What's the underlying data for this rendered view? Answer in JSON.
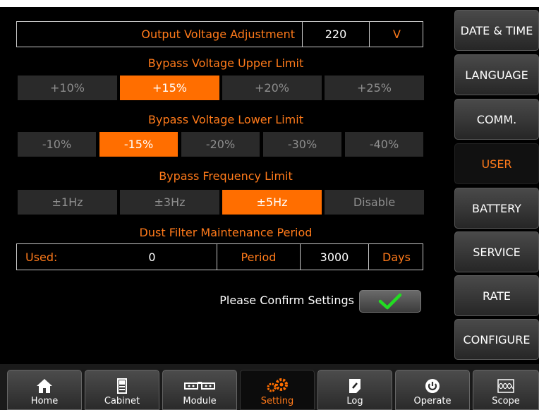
{
  "output_voltage": {
    "label": "Output Voltage Adjustment",
    "value": "220",
    "unit": "V"
  },
  "bypass_upper": {
    "title": "Bypass Voltage Upper Limit",
    "options": [
      "+10%",
      "+15%",
      "+20%",
      "+25%"
    ],
    "selected": "+15%"
  },
  "bypass_lower": {
    "title": "Bypass Voltage Lower Limit",
    "options": [
      "-10%",
      "-15%",
      "-20%",
      "-30%",
      "-40%"
    ],
    "selected": "-15%"
  },
  "bypass_freq": {
    "title": "Bypass Frequency Limit",
    "options": [
      "±1Hz",
      "±3Hz",
      "±5Hz",
      "Disable"
    ],
    "selected": "±5Hz"
  },
  "dust_filter": {
    "title": "Dust Filter Maintenance Period",
    "used_label": "Used:",
    "used_value": "0",
    "period_label": "Period",
    "period_value": "3000",
    "unit": "Days"
  },
  "confirm": {
    "label": "Please Confirm Settings",
    "icon": "check-icon"
  },
  "right_menu": {
    "items": [
      "DATE & TIME",
      "LANGUAGE",
      "COMM.",
      "USER",
      "BATTERY",
      "SERVICE",
      "RATE",
      "CONFIGURE"
    ],
    "active": "USER"
  },
  "bottom_nav": {
    "items": [
      {
        "label": "Home",
        "icon": "home-icon"
      },
      {
        "label": "Cabinet",
        "icon": "cabinet-icon"
      },
      {
        "label": "Module",
        "icon": "module-icon"
      },
      {
        "label": "Setting",
        "icon": "gear-icon"
      },
      {
        "label": "Log",
        "icon": "log-icon"
      },
      {
        "label": "Operate",
        "icon": "power-icon"
      },
      {
        "label": "Scope",
        "icon": "scope-icon"
      }
    ],
    "active": "Setting"
  },
  "colors": {
    "accent": "#ff6e00",
    "text_orange": "#ff7a1a",
    "check": "#22dd22",
    "background": "#000000"
  }
}
